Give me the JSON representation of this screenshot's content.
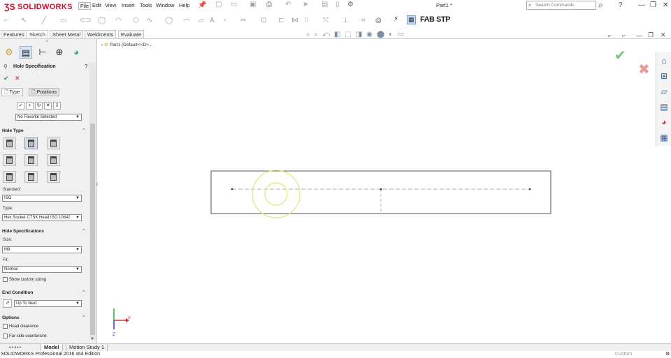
{
  "app": {
    "logo_text": "SOLIDWORKS",
    "document_title": "Part1 *",
    "search_placeholder": "Search Commands",
    "fab_label": "FAB STP"
  },
  "menu": [
    "File",
    "Edit",
    "View",
    "Insert",
    "Tools",
    "Window",
    "Help"
  ],
  "command_tabs": [
    "Features",
    "Sketch",
    "Sheet Metal",
    "Weldments",
    "Evaluate"
  ],
  "active_command_tab": "Sketch",
  "tree": {
    "root_label": "Part1  (Default<<D>..."
  },
  "property_manager": {
    "title": "Hole Specification",
    "subtabs": [
      "Type",
      "Positions"
    ],
    "favorite": {
      "value": "No Favorite Selected"
    },
    "hole_type": {
      "section_label": "Hole Type",
      "standard_label": "Standard:",
      "standard_value": "ISO",
      "type_label": "Type:",
      "type_value": "Hex Socket CTSK Head ISO 10642"
    },
    "hole_specifications": {
      "section_label": "Hole Specifications",
      "size_label": "Size:",
      "size_value": "M8",
      "fit_label": "Fit:",
      "fit_value": "Normal",
      "custom_sizing_label": "Show custom sizing"
    },
    "end_condition": {
      "section_label": "End Condition",
      "value": "Up To Next"
    },
    "options": {
      "section_label": "Options",
      "items": [
        "Head clearance",
        "Far side countersink"
      ]
    }
  },
  "bottom_tabs": [
    "Model",
    "Motion Study 1"
  ],
  "active_bottom_tab": "Model",
  "status": {
    "left": "SOLIDWORKS Professional 2016 x64 Edition",
    "units": "Custom"
  },
  "colors": {
    "brand_red": "#c8102e",
    "sketch_yellow": "#e8e27a",
    "ok_green": "#2a9d3a",
    "cancel_red": "#cc1f1f"
  }
}
